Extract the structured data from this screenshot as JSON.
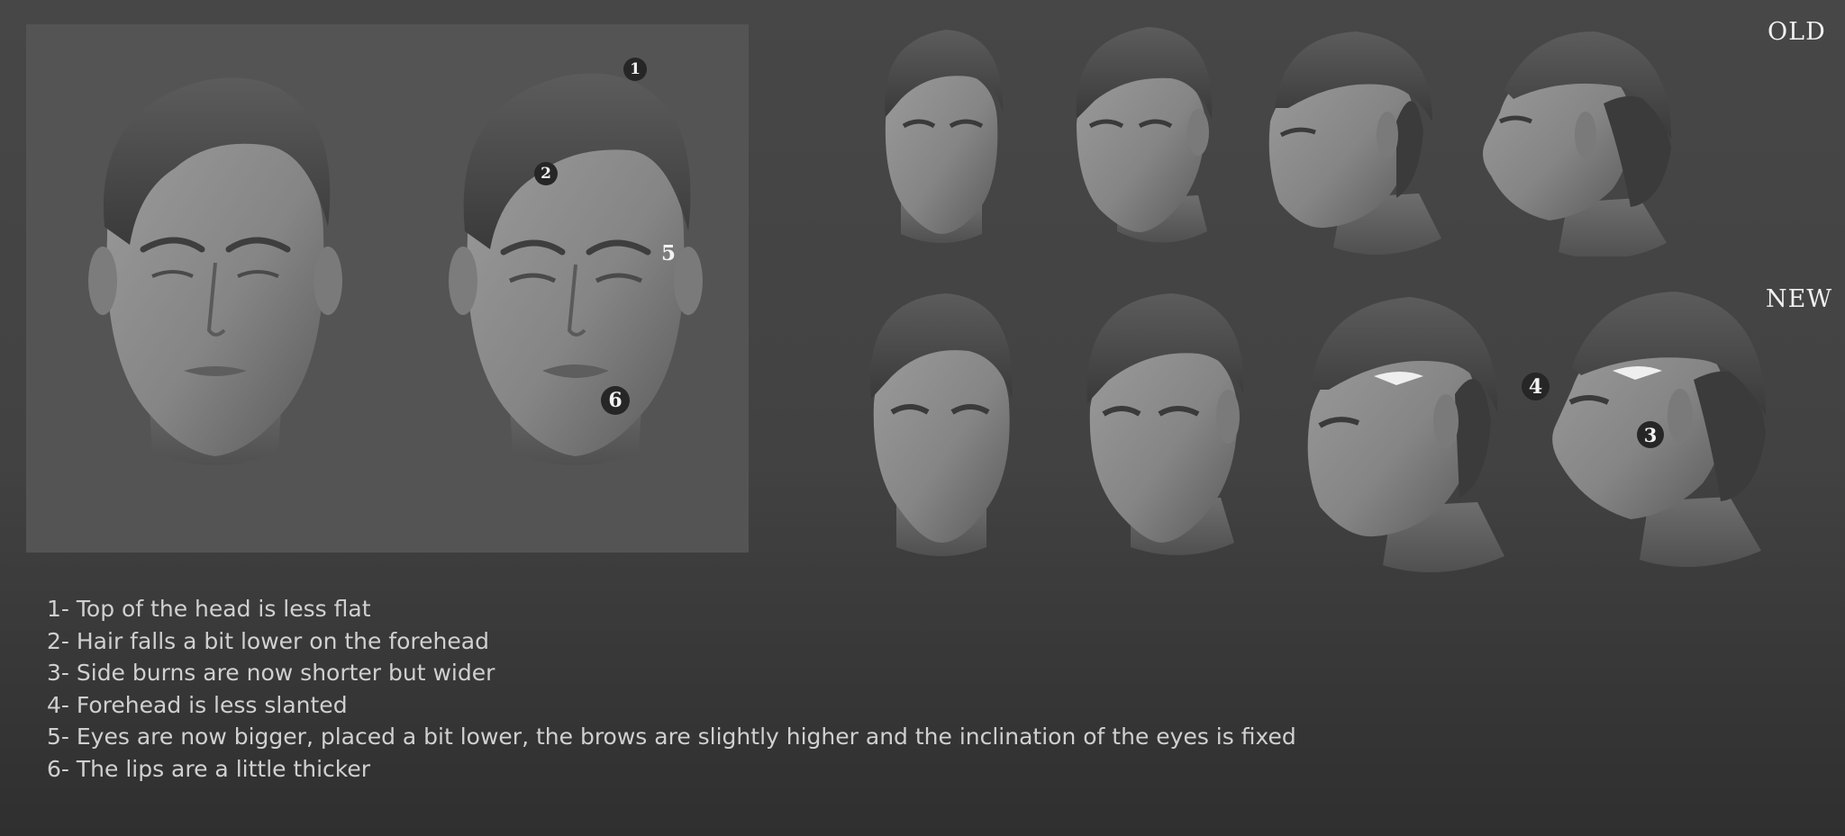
{
  "row_labels": {
    "old": "OLD",
    "new": "NEW"
  },
  "markers": {
    "m1": "1",
    "m2": "2",
    "m5": "5",
    "m6": "6",
    "m4": "4",
    "m3": "3"
  },
  "notes": [
    "1- Top of the head is less flat",
    "2- Hair falls a bit lower on the forehead",
    "3- Side burns are now shorter but wider",
    "4- Forehead is less slanted",
    "5- Eyes are now bigger, placed a bit lower, the brows are slightly higher and the inclination of the eyes is fixed",
    "6- The lips are a little thicker"
  ],
  "colors": {
    "background": "#454545",
    "panel": "#545454",
    "marker": "#262626",
    "text": "#d0d0d0"
  }
}
